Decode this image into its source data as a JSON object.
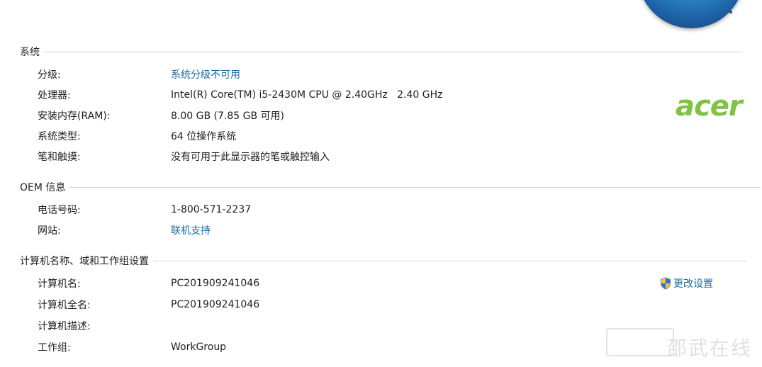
{
  "system": {
    "title": "系统",
    "rows": [
      {
        "label": "分级:",
        "value": "系统分级不可用"
      },
      {
        "label": "处理器:",
        "value": "Intel(R) Core(TM) i5-2430M CPU @ 2.40GHz   2.40 GHz"
      },
      {
        "label": "安装内存(RAM):",
        "value": "8.00 GB (7.85 GB 可用)"
      },
      {
        "label": "系统类型:",
        "value": "64 位操作系统"
      },
      {
        "label": "笔和触摸:",
        "value": "没有可用于此显示器的笔或触控输入"
      }
    ]
  },
  "oem": {
    "title": "OEM 信息",
    "logo_text": "acer",
    "rows": [
      {
        "label": "电话号码:",
        "value": "1-800-571-2237"
      },
      {
        "label": "网站:",
        "value": "联机支持"
      }
    ]
  },
  "computer": {
    "title": "计算机名称、域和工作组设置",
    "change_settings_label": "更改设置",
    "rows": [
      {
        "label": "计算机名:",
        "value": "PC201909241046"
      },
      {
        "label": "计算机全名:",
        "value": "PC201909241046"
      },
      {
        "label": "计算机描述:",
        "value": ""
      },
      {
        "label": "工作组:",
        "value": "WorkGroup"
      }
    ]
  },
  "watermark": {
    "text": "邵武在线"
  },
  "colors": {
    "link": "#1c6aa3",
    "acer": "#80c242",
    "divider": "#d2d2d2"
  }
}
